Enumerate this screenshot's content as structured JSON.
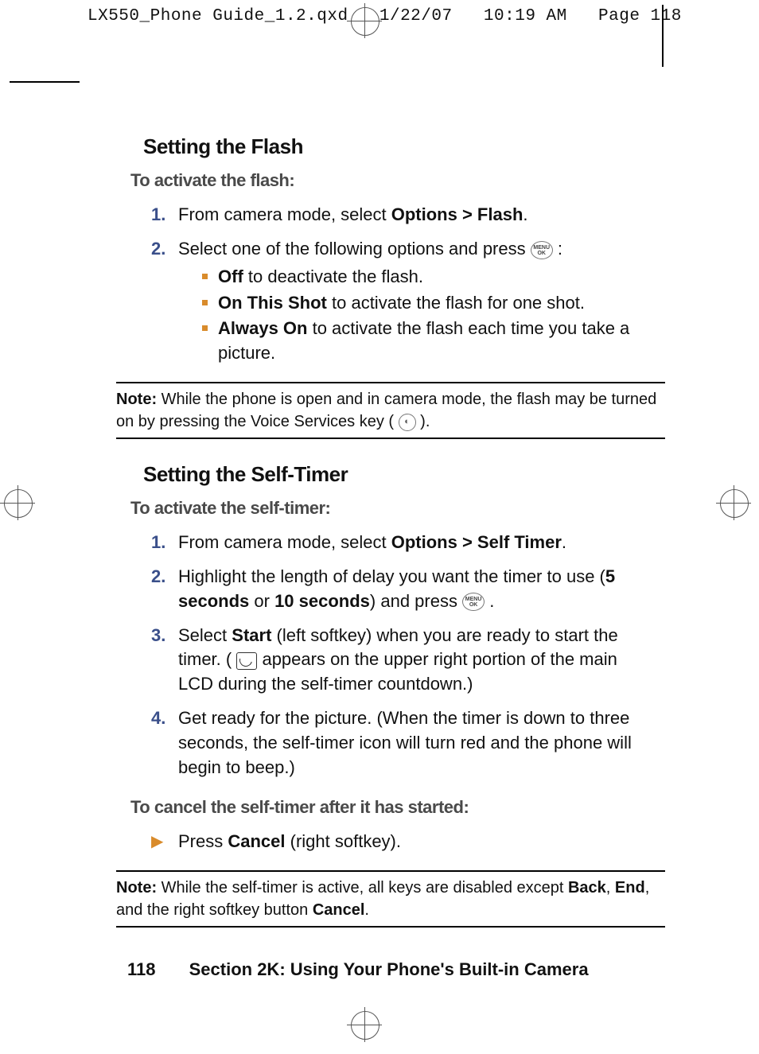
{
  "print_header": {
    "filename": "LX550_Phone Guide_1.2.qxd",
    "date": "1/22/07",
    "time": "10:19 AM",
    "page_label": "Page 118"
  },
  "sections": {
    "flash": {
      "title": "Setting the Flash",
      "subhead": "To activate the flash:",
      "steps": {
        "num1": "1.",
        "s1_pre": "From camera mode, select ",
        "s1_bold": "Options > Flash",
        "s1_post": ".",
        "num2": "2.",
        "s2_pre": "Select one of the following options and press ",
        "s2_post": " :",
        "sub_off_b": "Off",
        "sub_off_t": " to deactivate the flash.",
        "sub_on_shot_b": "On This Shot",
        "sub_on_shot_t": " to activate the flash for one shot.",
        "sub_always_b": "Always On",
        "sub_always_t": " to activate the flash each time you take a picture."
      },
      "note": {
        "label": "Note:",
        "pre": " While the phone is open and in camera mode, the flash may be turned on by pressing the Voice Services key ( ",
        "post": " )."
      }
    },
    "selftimer": {
      "title": "Setting the Self-Timer",
      "subhead": "To activate the self-timer:",
      "steps": {
        "num1": "1.",
        "s1_pre": "From camera mode, select ",
        "s1_bold": "Options > Self Timer",
        "s1_post": ".",
        "num2": "2.",
        "s2_pre": "Highlight the length of delay you want the timer to use (",
        "s2_b1": "5 seconds",
        "s2_mid": " or ",
        "s2_b2": "10 seconds",
        "s2_after": ") and press ",
        "s2_post": " .",
        "num3": "3.",
        "s3_pre": "Select ",
        "s3_b": "Start",
        "s3_mid": " (left softkey) when you are ready to start the timer. ( ",
        "s3_post": "  appears on the upper right portion of the main LCD during the self-timer countdown.)",
        "num4": "4.",
        "s4": "Get ready for the picture. (When the timer is down to three seconds, the self-timer icon will turn red and the phone will begin to beep.)"
      },
      "cancel_head": "To cancel the self-timer after it has started:",
      "cancel_pre": "Press ",
      "cancel_b": "Cancel",
      "cancel_post": " (right softkey).",
      "note2": {
        "label": "Note:",
        "pre": " While the self-timer is active, all keys are disabled except ",
        "b1": "Back",
        "mid1": ", ",
        "b2": "End",
        "mid2": ", and the right softkey button ",
        "b3": "Cancel",
        "post": "."
      }
    }
  },
  "footer": {
    "page_number": "118",
    "section_label": "Section 2K: Using Your Phone's Built-in Camera"
  },
  "icons": {
    "menu_ok": "MENU\nOK"
  }
}
